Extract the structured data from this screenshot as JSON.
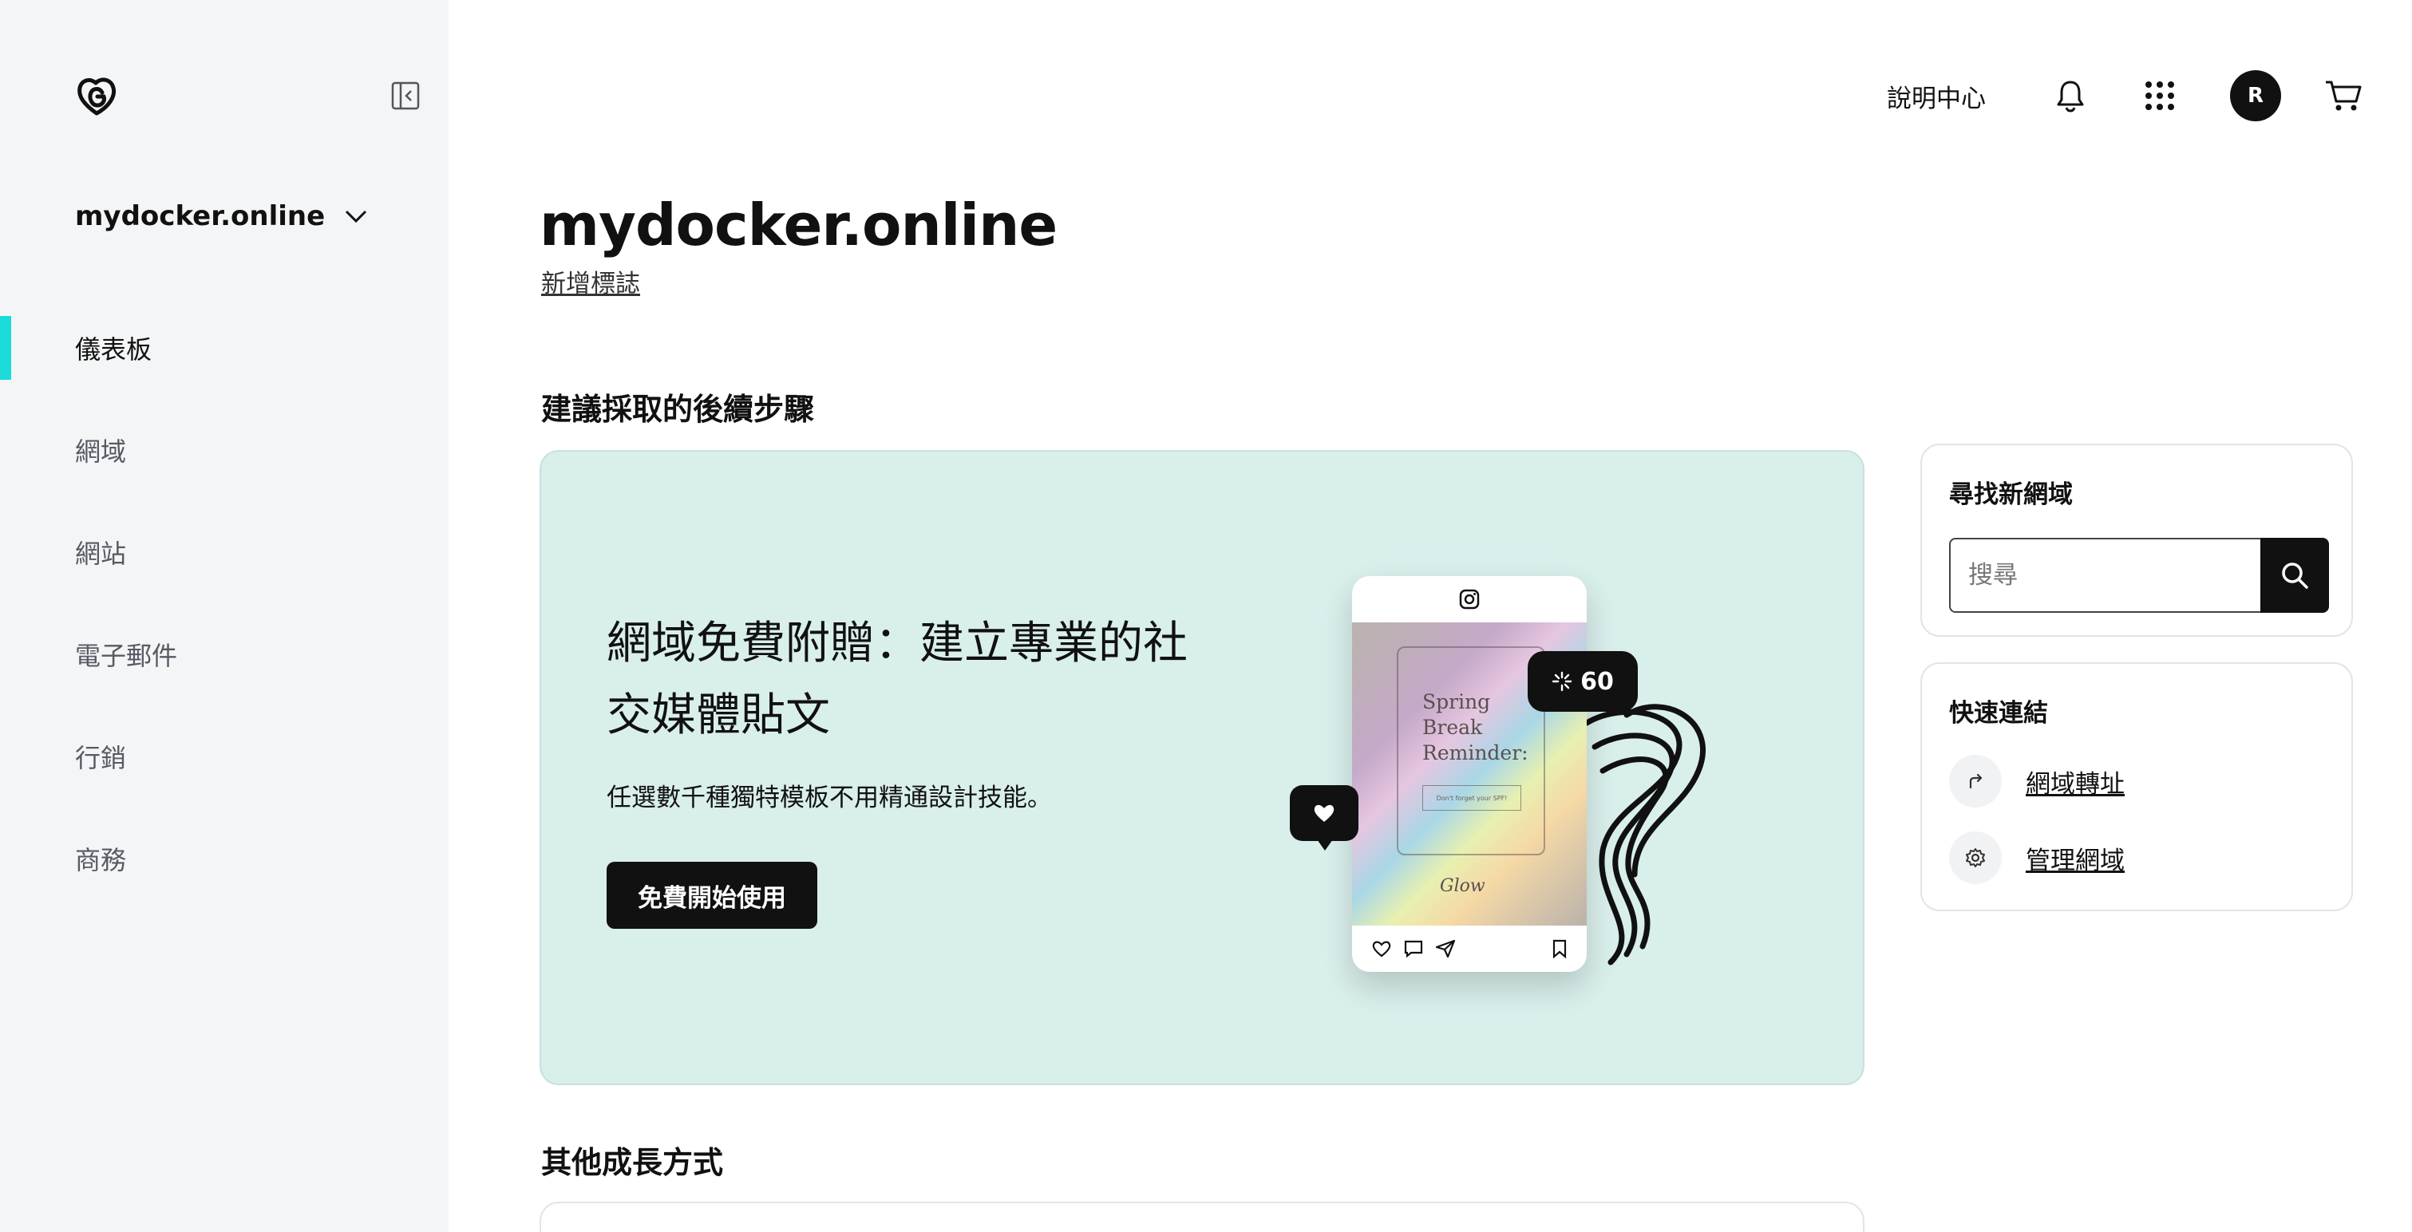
{
  "sidebar": {
    "domain_selector": "mydocker.online",
    "nav": [
      "儀表板",
      "網域",
      "網站",
      "電子郵件",
      "行銷",
      "商務"
    ]
  },
  "topbar": {
    "help": "說明中心",
    "avatar_initial": "R"
  },
  "main": {
    "title": "mydocker.online",
    "add_logo": "新增標誌",
    "next_steps_title": "建議採取的後續步驟",
    "growth_title": "其他成長方式"
  },
  "promo": {
    "headline": "網域免費附贈：建立專業的社交媒體貼文",
    "subtext": "任選數千種獨特模板不用精通設計技能。",
    "cta": "免費開始使用",
    "illustration": {
      "card_text": "Spring Break Reminder:",
      "card_button": "Don't forget your SPF!",
      "signature": "Glow",
      "likes": "60"
    }
  },
  "find_domain": {
    "title": "尋找新網域",
    "placeholder": "搜尋"
  },
  "quick_links": {
    "title": "快速連結",
    "items": [
      "網域轉址",
      "管理網域"
    ]
  },
  "colors": {
    "active_accent": "#1bdbdb",
    "promo_bg": "#d9efec",
    "sidebar_bg": "#f4f5f7"
  }
}
